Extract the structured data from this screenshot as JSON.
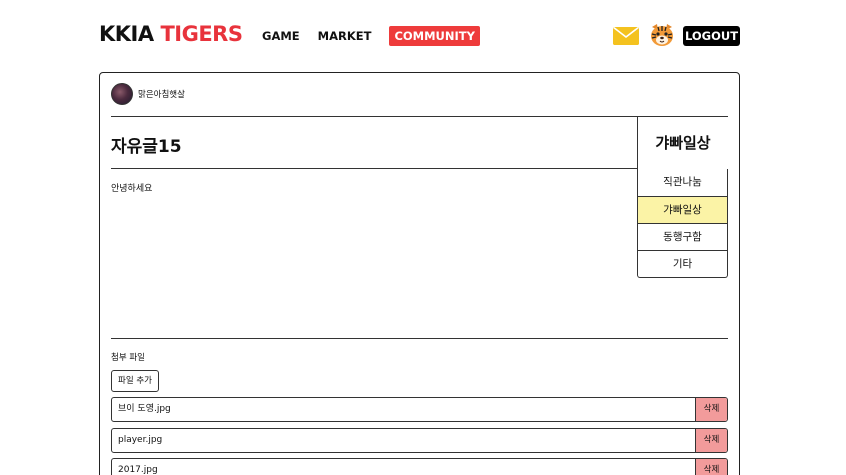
{
  "header": {
    "logo_part1": "KKIA",
    "logo_part2": "TIGERS",
    "nav": [
      "GAME",
      "MARKET",
      "COMMUNITY"
    ],
    "active_nav": "COMMUNITY",
    "logout_label": "LOGOUT",
    "icons": [
      "mail-icon",
      "tiger-icon"
    ]
  },
  "post": {
    "author": "맑은아침햇살",
    "title": "자유글15",
    "body": "안녕하세요",
    "category": "갸빠일상"
  },
  "categories": {
    "items": [
      "직관나눔",
      "갸빠일상",
      "동행구함",
      "기타"
    ],
    "selected": "갸빠일상"
  },
  "attachments": {
    "label": "첨부 파일",
    "add_label": "파일 추가",
    "delete_label": "삭제",
    "files": [
      "브이 도영.jpg",
      "player.jpg",
      "2017.jpg"
    ]
  },
  "colors": {
    "brand_red": "#e8333c",
    "nav_active_bg": "#ee3b3b",
    "selected_category_bg": "#fbf3a6",
    "delete_bg": "#f29b9b",
    "mail_icon": "#f4c21f"
  }
}
